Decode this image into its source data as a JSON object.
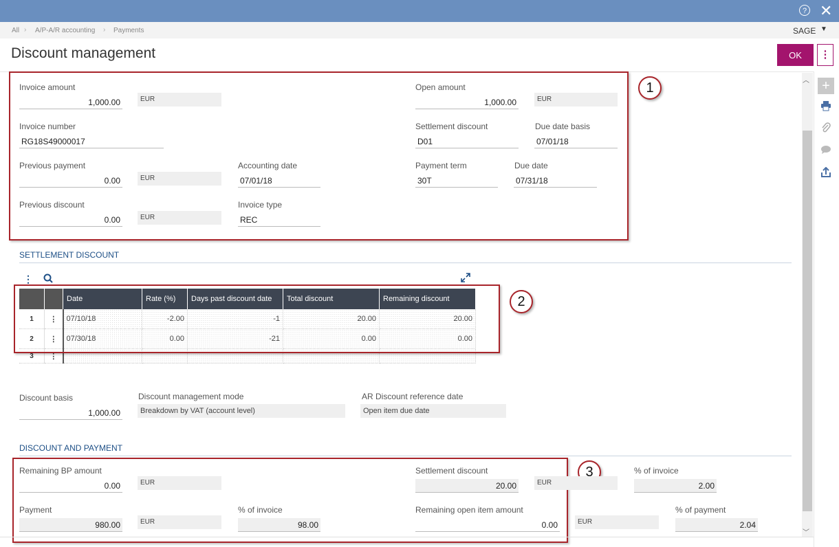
{
  "window": {
    "help_icon": "?",
    "close_icon": "✕"
  },
  "breadcrumb": [
    "All",
    "A/P-A/R accounting",
    "Payments"
  ],
  "user": {
    "name": "SAGE"
  },
  "header": {
    "title": "Discount management",
    "ok_label": "OK"
  },
  "invoice": {
    "invoice_amount_label": "Invoice amount",
    "invoice_amount": "1,000.00",
    "invoice_currency": "EUR",
    "open_amount_label": "Open amount",
    "open_amount": "1,000.00",
    "open_currency": "EUR",
    "invoice_number_label": "Invoice number",
    "invoice_number": "RG18S49000017",
    "settlement_discount_label": "Settlement discount",
    "settlement_discount": "D01",
    "due_date_basis_label": "Due date basis",
    "due_date_basis": "07/01/18",
    "previous_payment_label": "Previous payment",
    "previous_payment": "0.00",
    "previous_payment_currency": "EUR",
    "accounting_date_label": "Accounting date",
    "accounting_date": "07/01/18",
    "payment_term_label": "Payment term",
    "payment_term": "30T",
    "due_date_label": "Due date",
    "due_date": "07/31/18",
    "previous_discount_label": "Previous discount",
    "previous_discount": "0.00",
    "previous_discount_currency": "EUR",
    "invoice_type_label": "Invoice type",
    "invoice_type": "REC"
  },
  "settlement_section": {
    "title": "SETTLEMENT DISCOUNT",
    "columns": [
      "Date",
      "Rate (%)",
      "Days past discount date",
      "Total discount",
      "Remaining discount"
    ],
    "rows": [
      {
        "num": "1",
        "date": "07/10/18",
        "rate": "-2.00",
        "days": "-1",
        "total": "20.00",
        "remaining": "20.00"
      },
      {
        "num": "2",
        "date": "07/30/18",
        "rate": "0.00",
        "days": "-21",
        "total": "0.00",
        "remaining": "0.00"
      },
      {
        "num": "3",
        "date": "",
        "rate": "",
        "days": "",
        "total": "",
        "remaining": ""
      }
    ],
    "discount_basis_label": "Discount basis",
    "discount_basis": "1,000.00",
    "mode_label": "Discount management mode",
    "mode": "Breakdown by VAT (account level)",
    "ref_date_label": "AR Discount reference date",
    "ref_date": "Open item due date"
  },
  "payment_section": {
    "title": "DISCOUNT AND PAYMENT",
    "remaining_bp_label": "Remaining BP amount",
    "remaining_bp": "0.00",
    "remaining_bp_currency": "EUR",
    "settlement_discount_label": "Settlement discount",
    "settlement_discount": "20.00",
    "settlement_discount_currency": "EUR",
    "pct_invoice_label": "% of invoice",
    "pct_invoice": "2.00",
    "payment_label": "Payment",
    "payment": "980.00",
    "payment_currency": "EUR",
    "payment_pct_invoice_label": "% of invoice",
    "payment_pct_invoice": "98.00",
    "remaining_open_label": "Remaining open item amount",
    "remaining_open": "0.00",
    "remaining_open_currency": "EUR",
    "pct_payment_label": "% of payment",
    "pct_payment": "2.04"
  },
  "callouts": [
    "1",
    "2",
    "3"
  ]
}
